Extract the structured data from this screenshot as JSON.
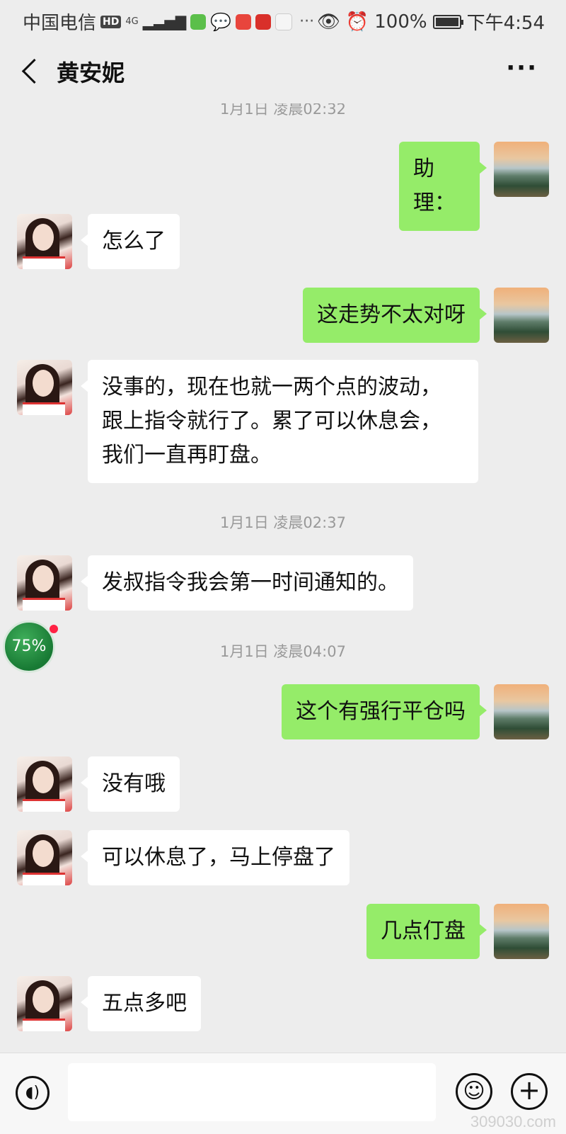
{
  "status_bar": {
    "carrier": "中国电信",
    "hd_badge": "HD",
    "network": "4G",
    "more_notifications": "···",
    "battery_percent": "100%",
    "battery_level": 1.0,
    "time": "下午4:54"
  },
  "header": {
    "title": "黄安妮",
    "more_label": "···"
  },
  "messages": {
    "ts0": "1月1日 凌晨02:32",
    "m1": "助理：",
    "m2": "怎么了",
    "m3": "这走势不太对呀",
    "m4a": "没事的，现在也就一两个点的波动，",
    "m4b": "跟上指令就行了。累了可以休息会，",
    "m4c": "我们一直再盯盘。",
    "ts1": "1月1日 凌晨02:37",
    "m5": "发叔指令我会第一时间通知的。",
    "ts2": "1月1日 凌晨04:07",
    "m6": "这个有强行平仓吗",
    "m7": "没有哦",
    "m8": "可以休息了，马上停盘了",
    "m9": "几点仃盘",
    "m10": "五点多吧"
  },
  "floating_ball": {
    "percent": "75%"
  },
  "input_bar": {
    "text_value": ""
  },
  "watermark": "309030.com",
  "colors": {
    "background": "#ededed",
    "outgoing_bubble": "#95ec69",
    "incoming_bubble": "#ffffff",
    "timestamp": "#999999"
  }
}
